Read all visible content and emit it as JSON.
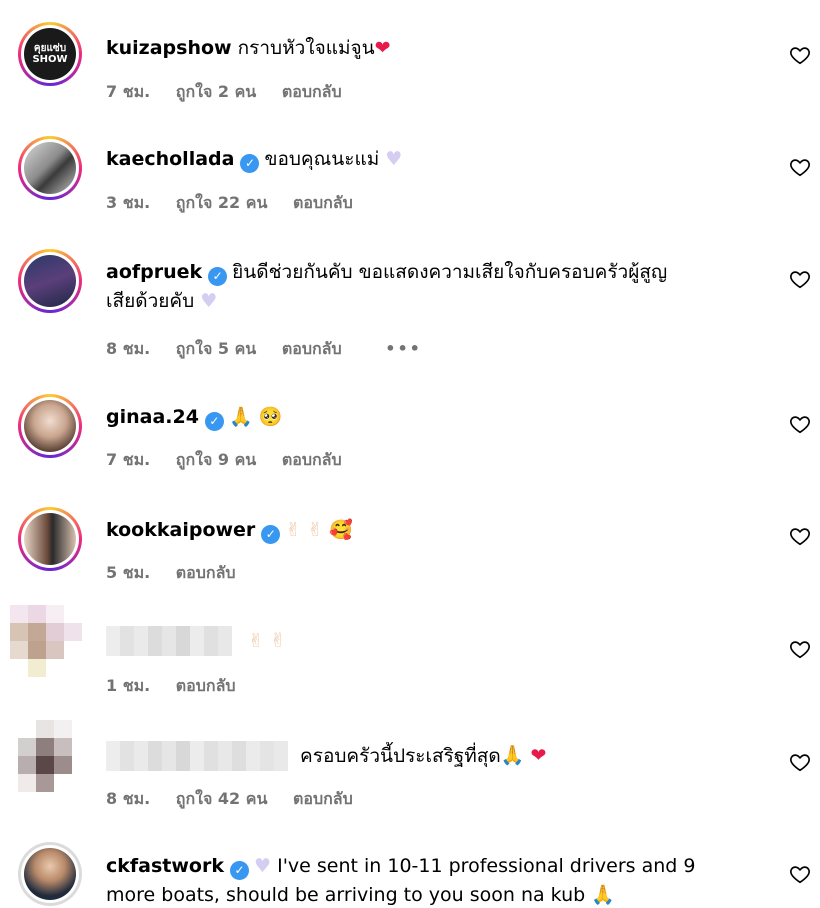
{
  "comments": [
    {
      "username": "kuizapshow",
      "verified": false,
      "text": "กราบหัวใจแม่จูน",
      "emojis": [
        "❤"
      ],
      "time": "7 ชม.",
      "likes": "ถูกใจ 2 คน",
      "reply": "ตอบกลับ",
      "avatar_text": "คุยแซ่บ SHOW"
    },
    {
      "username": "kaechollada",
      "verified": true,
      "text": "ขอบคุณนะแม่",
      "emojis": [
        "♥"
      ],
      "time": "3 ชม.",
      "likes": "ถูกใจ 22 คน",
      "reply": "ตอบกลับ"
    },
    {
      "username": "aofpruek",
      "verified": true,
      "text_line1": "ยินดีช่วยกันคับ ขอแสดงความเสียใจกับครอบครัวผู้สูญ",
      "text_line2": "เสียด้วยคับ",
      "emojis": [
        "♥"
      ],
      "time": "8 ชม.",
      "likes": "ถูกใจ 5 คน",
      "reply": "ตอบกลับ",
      "more": "•••"
    },
    {
      "username": "ginaa.24",
      "verified": true,
      "emojis": [
        "🙏",
        "🥺"
      ],
      "time": "7 ชม.",
      "likes": "ถูกใจ 9 คน",
      "reply": "ตอบกลับ"
    },
    {
      "username": "kookkaipower",
      "verified": true,
      "emojis": [
        "✌",
        "✌",
        "🥰"
      ],
      "time": "5 ชม.",
      "reply": "ตอบกลับ"
    },
    {
      "username": "",
      "verified": false,
      "emojis": [
        "✌",
        "✌"
      ],
      "time": "1 ชม.",
      "reply": "ตอบกลับ"
    },
    {
      "username": "",
      "verified": false,
      "text": "ครอบครัวนี้ประเสริฐที่สุด",
      "emojis": [
        "🙏",
        "❤"
      ],
      "time": "8 ชม.",
      "likes": "ถูกใจ 42 คน",
      "reply": "ตอบกลับ"
    },
    {
      "username": "ckfastwork",
      "verified": true,
      "emoji_lead": "♥",
      "text_line1": "I've sent in 10-11 professional drivers and 9",
      "text_line2": "more boats, should be arriving to you soon na kub",
      "emojis": [
        "🙏"
      ]
    }
  ],
  "colors": {
    "meta_gray": "#737373",
    "verified_blue": "#3897f0",
    "heart_red": "#e8194b",
    "heart_lavender": "#d6cdf2"
  },
  "icons": {
    "like": "heart-outline-icon",
    "verified": "verified-badge-icon"
  }
}
